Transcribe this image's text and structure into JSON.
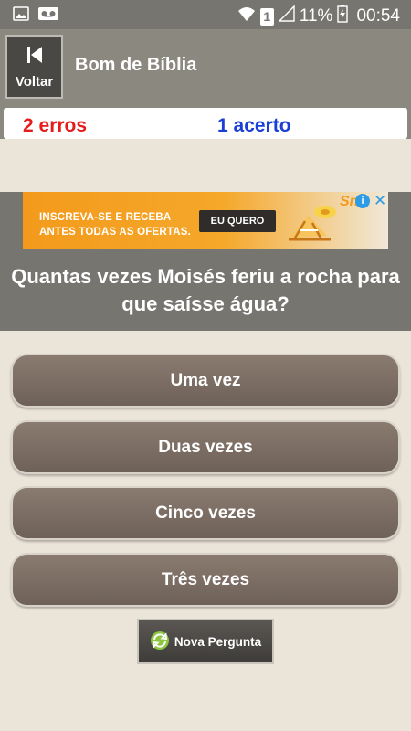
{
  "status_bar": {
    "battery_percent": "11%",
    "time": "00:54",
    "sim_badge": "1",
    "icons": [
      "image-icon",
      "voicemail-icon",
      "wifi-icon",
      "signal-icon",
      "battery-charging-icon"
    ]
  },
  "header": {
    "back_label": "Voltar",
    "title": "Bom de Bíblia"
  },
  "score": {
    "errors": "2 erros",
    "hits": "1 acerto"
  },
  "ad": {
    "text_line1": "INSCREVA-SE E RECEBA",
    "text_line2": "ANTES TODAS AS OFERTAS.",
    "cta": "EU QUERO",
    "brand": "Sn",
    "info": "i",
    "close": "✕"
  },
  "question": {
    "text": "Quantas vezes Moisés feriu a rocha para que saísse água?"
  },
  "answers": [
    {
      "label": "Uma vez"
    },
    {
      "label": "Duas vezes"
    },
    {
      "label": "Cinco vezes"
    },
    {
      "label": "Três vezes"
    }
  ],
  "new_question": {
    "label": "Nova Pergunta"
  },
  "colors": {
    "errors": "#e61c1c",
    "hits": "#1a3fd6",
    "background": "#ebe4d9",
    "bar": "#777570",
    "ad_orange": "#f39a1c"
  }
}
